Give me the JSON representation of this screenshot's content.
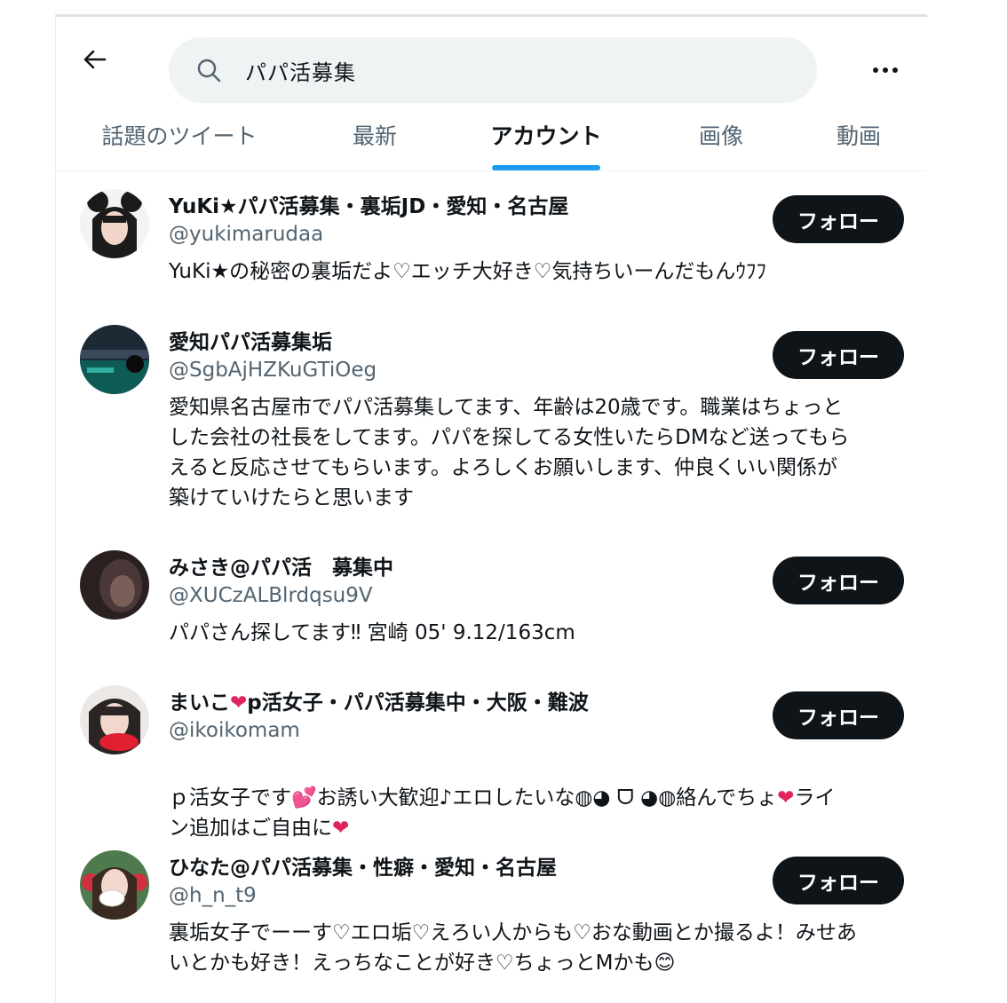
{
  "header": {
    "back_icon": "arrow-left-icon",
    "search_icon": "search-icon",
    "search_query": "パパ活募集",
    "more_icon": "more-horizontal-icon"
  },
  "tabs": [
    {
      "label": "話題のツイート",
      "active": false
    },
    {
      "label": "最新",
      "active": false
    },
    {
      "label": "アカウント",
      "active": true
    },
    {
      "label": "画像",
      "active": false
    },
    {
      "label": "動画",
      "active": false
    }
  ],
  "accent_color": "#1d9bf0",
  "accounts": [
    {
      "name": "YuKi★パパ活募集・裏垢JD・愛知・名古屋",
      "handle": "@yukimarudaa",
      "bio": "YuKi★の秘密の裏垢だよ♡エッチ大好き♡気持ちいーんだもんｳﾌﾌ",
      "follow_label": "フォロー"
    },
    {
      "name": "愛知パパ活募集垢",
      "handle": "@SgbAjHZKuGTiOeg",
      "bio": "愛知県名古屋市でパパ活募集してます、年齢は20歳です。職業はちょっと\nした会社の社長をしてます。パパを探してる女性いたらDMなど送ってもら\nえると反応させてもらいます。よろしくお願いします、仲良くいい関係が\n築けていけたらと思います",
      "follow_label": "フォロー"
    },
    {
      "name": "みさき@パパ活　募集中",
      "handle": "@XUCzALBlrdqsu9V",
      "bio": "パパさん探してます‼︎ 宮崎 05' 9.12/163cm",
      "follow_label": "フォロー"
    },
    {
      "name": "まいこ",
      "name_heart": "❤",
      "name_suffix": "p活女子・パパ活募集中・大阪・難波",
      "handle": "@ikoikomam",
      "bio_line1": "ｐ活女子です",
      "bio_heart1": "💕",
      "bio_line1b": "お誘い大歓迎♪エロしたいな◍◕ ᗜ ◕◍絡んでちょ",
      "bio_heart2": "❤",
      "bio_line1c": "ライ",
      "bio_line2": "ン追加はご自由に",
      "bio_heart3": "❤",
      "follow_label": "フォロー"
    },
    {
      "name": "ひなた@パパ活募集・性癖・愛知・名古屋",
      "handle": "@h_n_t9",
      "bio": "裏垢女子でーーす♡エロ垢♡えろい人からも♡おな動画とか撮るよ！みせあ\nいとかも好き！えっちなことが好き♡ちょっとMかも😊",
      "follow_label": "フォロー"
    }
  ]
}
